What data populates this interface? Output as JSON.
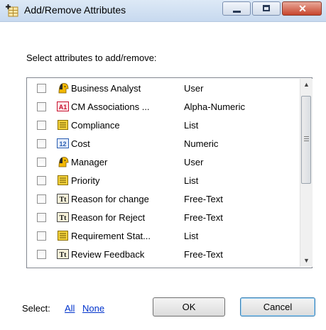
{
  "window": {
    "title": "Add/Remove Attributes",
    "close_symbol": "✕",
    "app_icon": "add-attribute-table-icon"
  },
  "prompt": "Select attributes to add/remove:",
  "attributes": [
    {
      "name": "Business Analyst",
      "type": "User",
      "icon": "user-icon",
      "checked": false
    },
    {
      "name": "CM Associations ...",
      "type": "Alpha-Numeric",
      "icon": "alpha-numeric-icon",
      "icon_text": "A1",
      "checked": false
    },
    {
      "name": "Compliance",
      "type": "List",
      "icon": "list-icon",
      "checked": false
    },
    {
      "name": "Cost",
      "type": "Numeric",
      "icon": "numeric-icon",
      "icon_text": "12",
      "checked": false
    },
    {
      "name": "Manager",
      "type": "User",
      "icon": "user-icon",
      "checked": false
    },
    {
      "name": "Priority",
      "type": "List",
      "icon": "list-icon",
      "checked": false
    },
    {
      "name": "Reason for change",
      "type": "Free-Text",
      "icon": "free-text-icon",
      "icon_text": "Tt",
      "checked": false
    },
    {
      "name": "Reason for Reject",
      "type": "Free-Text",
      "icon": "free-text-icon",
      "icon_text": "Tt",
      "checked": false
    },
    {
      "name": "Requirement Stat...",
      "type": "List",
      "icon": "list-icon",
      "checked": false
    },
    {
      "name": "Review Feedback",
      "type": "Free-Text",
      "icon": "free-text-icon",
      "icon_text": "Tt",
      "checked": false
    }
  ],
  "scroll": {
    "up": "▲",
    "down": "▼",
    "position": 0.0
  },
  "footer": {
    "select_label": "Select:",
    "all_link": "All",
    "none_link": "None",
    "ok_label": "OK",
    "cancel_label": "Cancel"
  },
  "colors": {
    "accent_link": "#0033cc",
    "close_button": "#c7452c",
    "user_icon": "#f2b705",
    "list_icon": "#f3d23c",
    "alpha_icon": "#c8102e",
    "numeric_icon": "#2a5db0"
  }
}
